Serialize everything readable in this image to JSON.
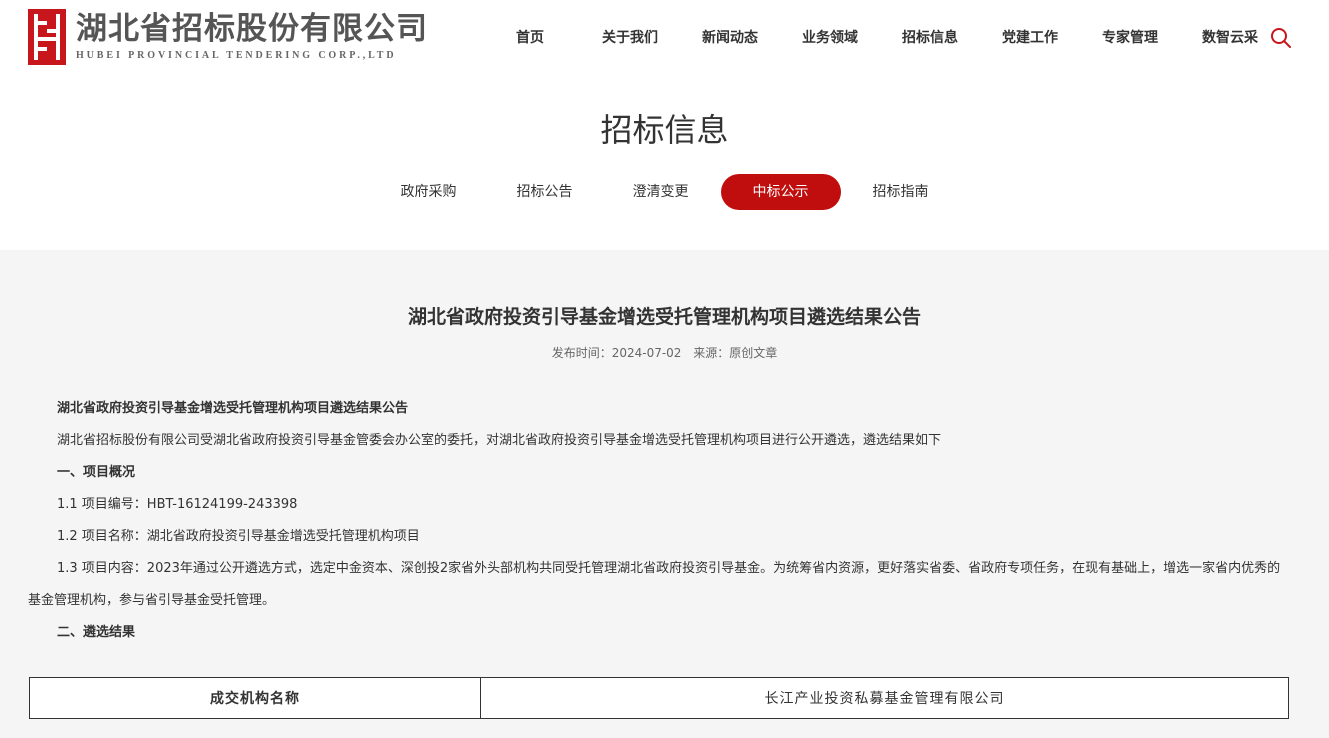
{
  "header": {
    "logo_cn": "湖北省招标股份有限公司",
    "logo_en": "HUBEI PROVINCIAL TENDERING CORP.,LTD",
    "nav": [
      "首页",
      "关于我们",
      "新闻动态",
      "业务领域",
      "招标信息",
      "党建工作",
      "专家管理",
      "数智云采"
    ],
    "search_icon": "search-icon"
  },
  "section": {
    "title": "招标信息",
    "tabs": [
      "政府采购",
      "招标公告",
      "澄清变更",
      "中标公示",
      "招标指南"
    ],
    "active_tab": "中标公示"
  },
  "article": {
    "title": "湖北省政府投资引导基金增选受托管理机构项目遴选结果公告",
    "meta_date": "发布时间：2024-07-02",
    "meta_source": "来源：原创文章",
    "paragraphs": {
      "p0": "湖北省政府投资引导基金增选受托管理机构项目遴选结果公告",
      "p1": "湖北省招标股份有限公司受湖北省政府投资引导基金管委会办公室的委托，对湖北省政府投资引导基金增选受托管理机构项目进行公开遴选，遴选结果如下",
      "p2": "一、项目概况",
      "p3": "1.1 项目编号：HBT-16124199-243398",
      "p4": "1.2 项目名称：湖北省政府投资引导基金增选受托管理机构项目",
      "p5": "1.3 项目内容：2023年通过公开遴选方式，选定中金资本、深创投2家省外头部机构共同受托管理湖北省政府投资引导基金。为统筹省内资源，更好落实省委、省政府专项任务，在现有基础上，增选一家省内优秀的基金管理机构，参与省引导基金受托管理。",
      "p6": "二、遴选结果"
    },
    "table": {
      "label": "成交机构名称",
      "value": "长江产业投资私募基金管理有限公司"
    }
  },
  "colors": {
    "brand_red": "#c8161d",
    "active_tab_bg": "#c00e0e",
    "content_bg": "#f5f5f5"
  }
}
